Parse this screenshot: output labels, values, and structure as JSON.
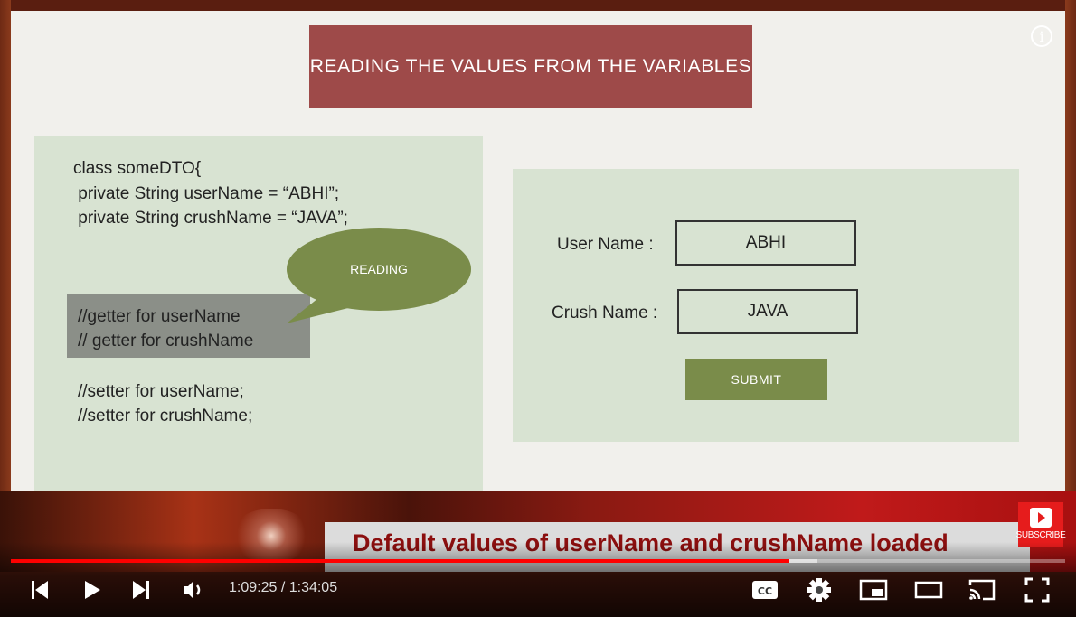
{
  "slide": {
    "title": "READING THE VALUES FROM THE VARIABLES",
    "code_lines": [
      "class someDTO{",
      " private String userName = “ABHI”;",
      " private String crushName = “JAVA”;"
    ],
    "getter_lines": [
      "//getter for userName",
      "// getter for crushName"
    ],
    "setter_lines": [
      "//setter for userName;",
      "//setter for crushName;"
    ],
    "bubble_text": "READING",
    "form": {
      "user_label": "User Name :",
      "user_value": "ABHI",
      "crush_label": "Crush Name :",
      "crush_value": "JAVA",
      "submit_label": "SUBMIT"
    }
  },
  "banner": {
    "caption": "Default values of userName and crushName loaded",
    "subscribe_label": "SUBSCRIBE"
  },
  "player": {
    "current_time": "1:09:25",
    "duration": "1:34:05",
    "time_display": "1:09:25 / 1:34:05",
    "progress_fraction": 0.738,
    "buffered_fraction": 0.765
  },
  "colors": {
    "title_bg": "#9e4a49",
    "panel_bg": "#d8e3d2",
    "bubble": "#7a8c4a",
    "progress": "#ff0000",
    "subscribe": "#e61c1c"
  },
  "icons": [
    "info-icon",
    "previous-icon",
    "play-icon",
    "next-icon",
    "volume-icon",
    "captions-icon",
    "settings-icon",
    "miniplayer-icon",
    "theater-icon",
    "cast-icon",
    "fullscreen-icon",
    "subscribe-icon"
  ]
}
